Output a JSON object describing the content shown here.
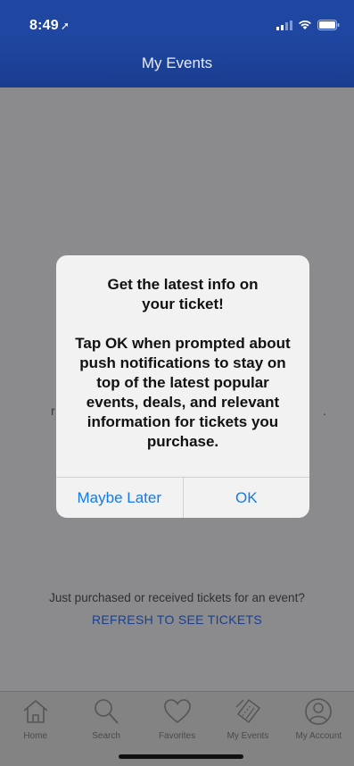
{
  "status_bar": {
    "time": "8:49",
    "location_glyph": "➚"
  },
  "nav": {
    "title": "My Events"
  },
  "background_text": {
    "left_fragment": "r",
    "right_fragment": "."
  },
  "prompt": {
    "message": "Just purchased or received tickets for an event?",
    "link": "REFRESH TO SEE TICKETS"
  },
  "tabs": [
    {
      "label": "Home",
      "icon": "home-icon"
    },
    {
      "label": "Search",
      "icon": "search-icon"
    },
    {
      "label": "Favorites",
      "icon": "heart-icon"
    },
    {
      "label": "My Events",
      "icon": "tickets-icon"
    },
    {
      "label": "My Account",
      "icon": "account-icon"
    }
  ],
  "alert": {
    "title_line1": "Get the latest info on",
    "title_line2": "your ticket!",
    "message_line1": "Tap OK when prompted about",
    "message_line2": "push notifications to stay on",
    "message_line3": "top of the latest popular",
    "message_line4": "events, deals, and relevant",
    "message_line5": "information for tickets you",
    "message_line6": "purchase.",
    "secondary_button": "Maybe Later",
    "primary_button": "OK"
  },
  "colors": {
    "header": "#1f46a0",
    "link": "#1b3f8e",
    "alert_button": "#1679e6"
  }
}
